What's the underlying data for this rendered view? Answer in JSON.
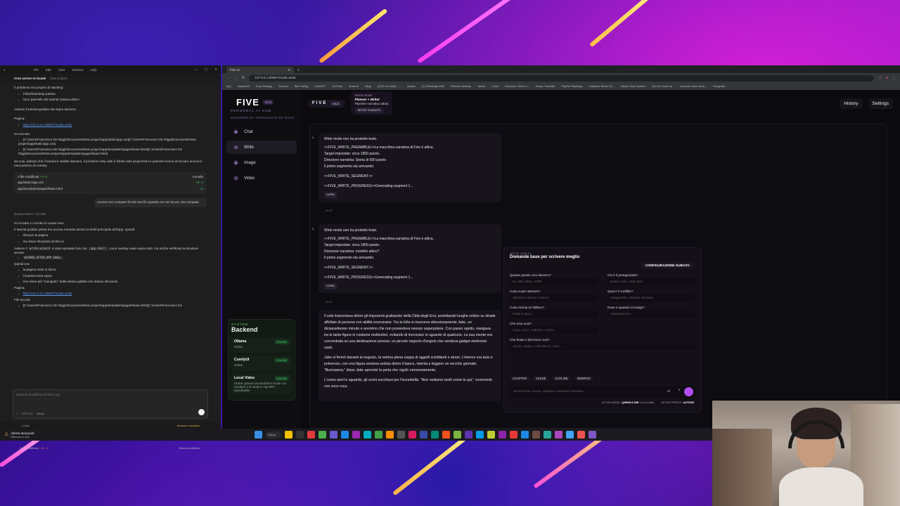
{
  "vscode": {
    "menu": [
      "File",
      "Edit",
      "View",
      "Window",
      "Help"
    ],
    "project_title": "Crea server IA locale",
    "project_sub": "New project",
    "intro": "Il problema era proprio di stacking:",
    "bullets1": [
      "il blur/backdrop partiva",
      "ma il pannello del tutorial restava dietro"
    ],
    "line2": "Adesso il tutorial guidato sta sopra davvero.",
    "page_label": "Pagina:",
    "page_link": "http://127.0.0.1:8000/?mode=write",
    "touched_label": "Ho toccato:",
    "touched": [
      "[C:\\Users\\Francesco De Riggi\\Documents\\New project\\app\\static\\app.css](C:\\Users\\Francesco De Riggi\\Documents\\New project\\app\\static\\app.css)",
      "[C:\\Users\\Francesco De Riggi\\Documents\\New project\\app\\templates\\pages\\base.html](C:\\Users\\Francesco De Riggi\\Documents\\New project\\app\\templates\\pages\\base.html)"
    ],
    "note": "Se vuoi, adesso che il tutorial è visibile davvero, il prossimo step utile è rifinire solo proporzioni e pulsanti invece di toccare ancora il meccanismo di overlay.",
    "files_header": "2 file modificati",
    "files_header_count": "+4 -2",
    "files_undo": "Annulla",
    "files": [
      {
        "name": "app/static/app.css",
        "delta": "+2 -2"
      },
      {
        "name": "app/templates/pages/base.html",
        "delta": "+2"
      }
    ],
    "user_msg": "Ancora non compare fai dei test fin quando non sei sicuro che compaia",
    "worked": "Durata lavoro: 1m 56s",
    "found": "Ho trovato e corretto la causa vera.",
    "found2": "Il tutorial guidato prima era ancora montato dentro la shell principale dell'app. Quindi:",
    "bullets2": [
      "sfocavo la pagina",
      "ma stavo sfocando anche lui"
    ],
    "now_text": "Adesso il",
    "now_code": "write-wizard",
    "now_text2": "è stato spostato fuori da",
    "now_code2": ".app-shell",
    "now_text3": ", come overlay reale sopra tutto. Ho anche verificato la struttura servita:",
    "wizard_code": "WIZARD_AFTER_APP_SHELL",
    "quindi": "Quindi ora:",
    "bullets3": [
      "la pagina sotto si sfoca",
      "il tutorial resta sopra",
      "non viene più \"mangiato\" dalla stessa gabbia che stiamo sfocando"
    ],
    "page_link2": "http://127.0.0.1:8000/?mode=write",
    "files_label": "File toccati:",
    "files_touched": "[C:\\Users\\Francesco De Riggi\\Documents\\New project\\app\\templates\\pages\\base.html](C:\\Users\\Francesco De",
    "mini_files": "2 file modificati",
    "mini_delta": "+38 -15",
    "review": "Rivedi modifiche",
    "input_placeholder": "Richiedi modifiche di follow-up",
    "model": "GPT-5.4",
    "effort": "Medio",
    "status_left": "Locale",
    "status_right": "Accesso completo"
  },
  "browser": {
    "tab_title": "Five v1",
    "url": "127.0.0.1:8000/?mode=write",
    "bookmarks": [
      "App",
      "Importanti",
      "Guru Strategy",
      "Account",
      "Bkt Trading",
      "ChatGPT",
      "YouTube",
      "Amazon",
      "eBay",
      "(1422 non lette) - ...",
      "Quotes",
      "(1) WhatsApp Web",
      "Remove Desktop",
      "Tanish",
      "Cloud",
      "Direzione: Torino e...",
      "DeepL Translate",
      "PayPal: Riepilogo",
      "Vodafone Rivers Vo...",
      "Italian Cloud System",
      "Fyn Ha: Solar Sy...",
      "Avvento Corso Medi...",
      "Fotografia"
    ]
  },
  "app": {
    "name": "FIVE",
    "version": "V1.0",
    "subtitle": "PERSONAL AI HUB",
    "designer": "DESIGNED BY FRANCESCO DE RIGGI",
    "nav": [
      {
        "icon": "◆",
        "label": "Chat"
      },
      {
        "icon": "W",
        "label": "Write"
      },
      {
        "icon": "◆",
        "label": "Image"
      },
      {
        "icon": "V",
        "label": "Video"
      }
    ],
    "backend_label": "SYSTEM",
    "backend_title": "Backend",
    "services": [
      {
        "name": "Ollama",
        "status": "Online",
        "badge": "ONLINE"
      },
      {
        "name": "ComfyUI",
        "status": "Online",
        "badge": "ONLINE"
      },
      {
        "name": "Local Video",
        "status": "Online: genera una keyframe locale con ComfyUI e la rende in clip MP4 riproducibile",
        "badge": "ONLINE"
      }
    ],
    "topbar": {
      "brand": "FIVE",
      "version": "V1.0",
      "mode_label": "WRITE MODE",
      "mode_title": "Planner + Writer",
      "mode_sub": "Pipeline narrativa attiva",
      "setup": "SETUP GUIDATO",
      "history": "History",
      "settings": "Settings"
    },
    "msg1": {
      "head": "Write mode non ha prodotto testo.",
      "l1": "<<FIVE_WRITE_PREAMBLE>>La macchina narrativa di Five è attiva.",
      "l2": "Target impostato: circa 1800 parole.",
      "l3": "Direzione narrativa: Storia di 500 parole",
      "l4": "Il primo segmento sta arrivando.",
      "l5": "<<FIVE_WRITE_SEGMENT>>",
      "l6": "<<FIVE_WRITE_PROGRESS>>Generating segment 1...",
      "copy": "COPIA",
      "time": "00:47"
    },
    "msg2": {
      "head": "Write mode non ha prodotto testo.",
      "l1": "<<FIVE_WRITE_PREAMBLE>>La macchina narrativa di Five è attiva.",
      "l2": "Target impostato: circa 1800 parole.",
      "l3": "Direzione narrativa: modello attivo?",
      "l4": "Il primo segmento sta arrivando.",
      "l5": "<<FIVE_WRITE_SEGMENT>>",
      "l6": "<<FIVE_WRITE_PROGRESS>>Generating segment 1...",
      "copy": "COPIA",
      "time": "00:47"
    },
    "story": {
      "p1": "Il sole tramontava dietro gli imponenti grattacielo della Città degli Eroi, proiettando lunghe ombre su strade affollate di persone con abilità sovrumane. Tra la folla si muoveva silenziosamente Jake, un diciassettenne minuto e anonimo che non possedeva nessun superpotere. Con passo rapido, navigava tra le tante figure in costume multicolori, evitando di incrociare lo sguardo di qualcuno. La sua mente era concentrata su una destinazione precisa: un piccolo negozio d'angolo che vendeva gadget elettronici usati.",
      "p2": "Jake si fermò davanti al negozio, la vetrina piena zeppa di oggetti scintillanti e strani. L'interno era buio e polveroso, con una figura anziana seduta dietro il banco, intenta a leggere un vecchio giornale. \"Buonasera,\" disse Jake aprendo la porta che cigolò rumorosamente.",
      "p3": "L'uomo alzò lo sguardo, gli occhi socchiusi per l'incredulità. \"Non vediamo molti come te qui,\" commentò con voce roca."
    },
    "wizard": {
      "label": "WRITE ASSIST",
      "title": "Domande base per scrivere meglio",
      "config": "CONFIGURAZIONE GUIDATA",
      "questions": [
        {
          "q": "Quante parole vuoi davvero?",
          "ph": "Es. 500, 3000, 10000"
        },
        {
          "q": "Chi è il protagonista?",
          "ph": "Nome, ruolo, tratto forte"
        },
        {
          "q": "Cosa vuole ottenere?",
          "ph": "Obiettivo esterno o interno"
        },
        {
          "q": "Qual è il conflitto?",
          "ph": "Antagonista, ostacolo, tensione"
        },
        {
          "q": "Cosa rischia se fallisce?",
          "ph": "Posta in gioco"
        },
        {
          "q": "Dove e quando si svolge?",
          "ph": "Ambientazione"
        },
        {
          "q": "Che tono vuoi?",
          "ph": "Cupo, epico, realistico, ironico..."
        },
        {
          "q": "",
          "ph": ""
        },
        {
          "q": "Che finale o direzione vuoi?",
          "ph": "Aperto, tragico, consolatorio, twist..."
        }
      ],
      "chips": [
        "CHAPTER",
        "SCENE",
        "OUTLINE",
        "REWRITE"
      ],
      "input_ph": "Scrivi trama, scena, capitolo o istruzioni narrative...",
      "foot1_label": "ACTIVE MODEL:",
      "foot1_val": "QWEN3.5 30B",
      "foot1_sub": "VIA OLLAMA",
      "foot2_label": "ACTIVE PROFILE:",
      "foot2_val": "AUTHOR"
    }
  },
  "taskbar": {
    "weather_title": "Allerta temporali",
    "weather_sub": "Rilevazioni ora",
    "search": "Cerca"
  }
}
